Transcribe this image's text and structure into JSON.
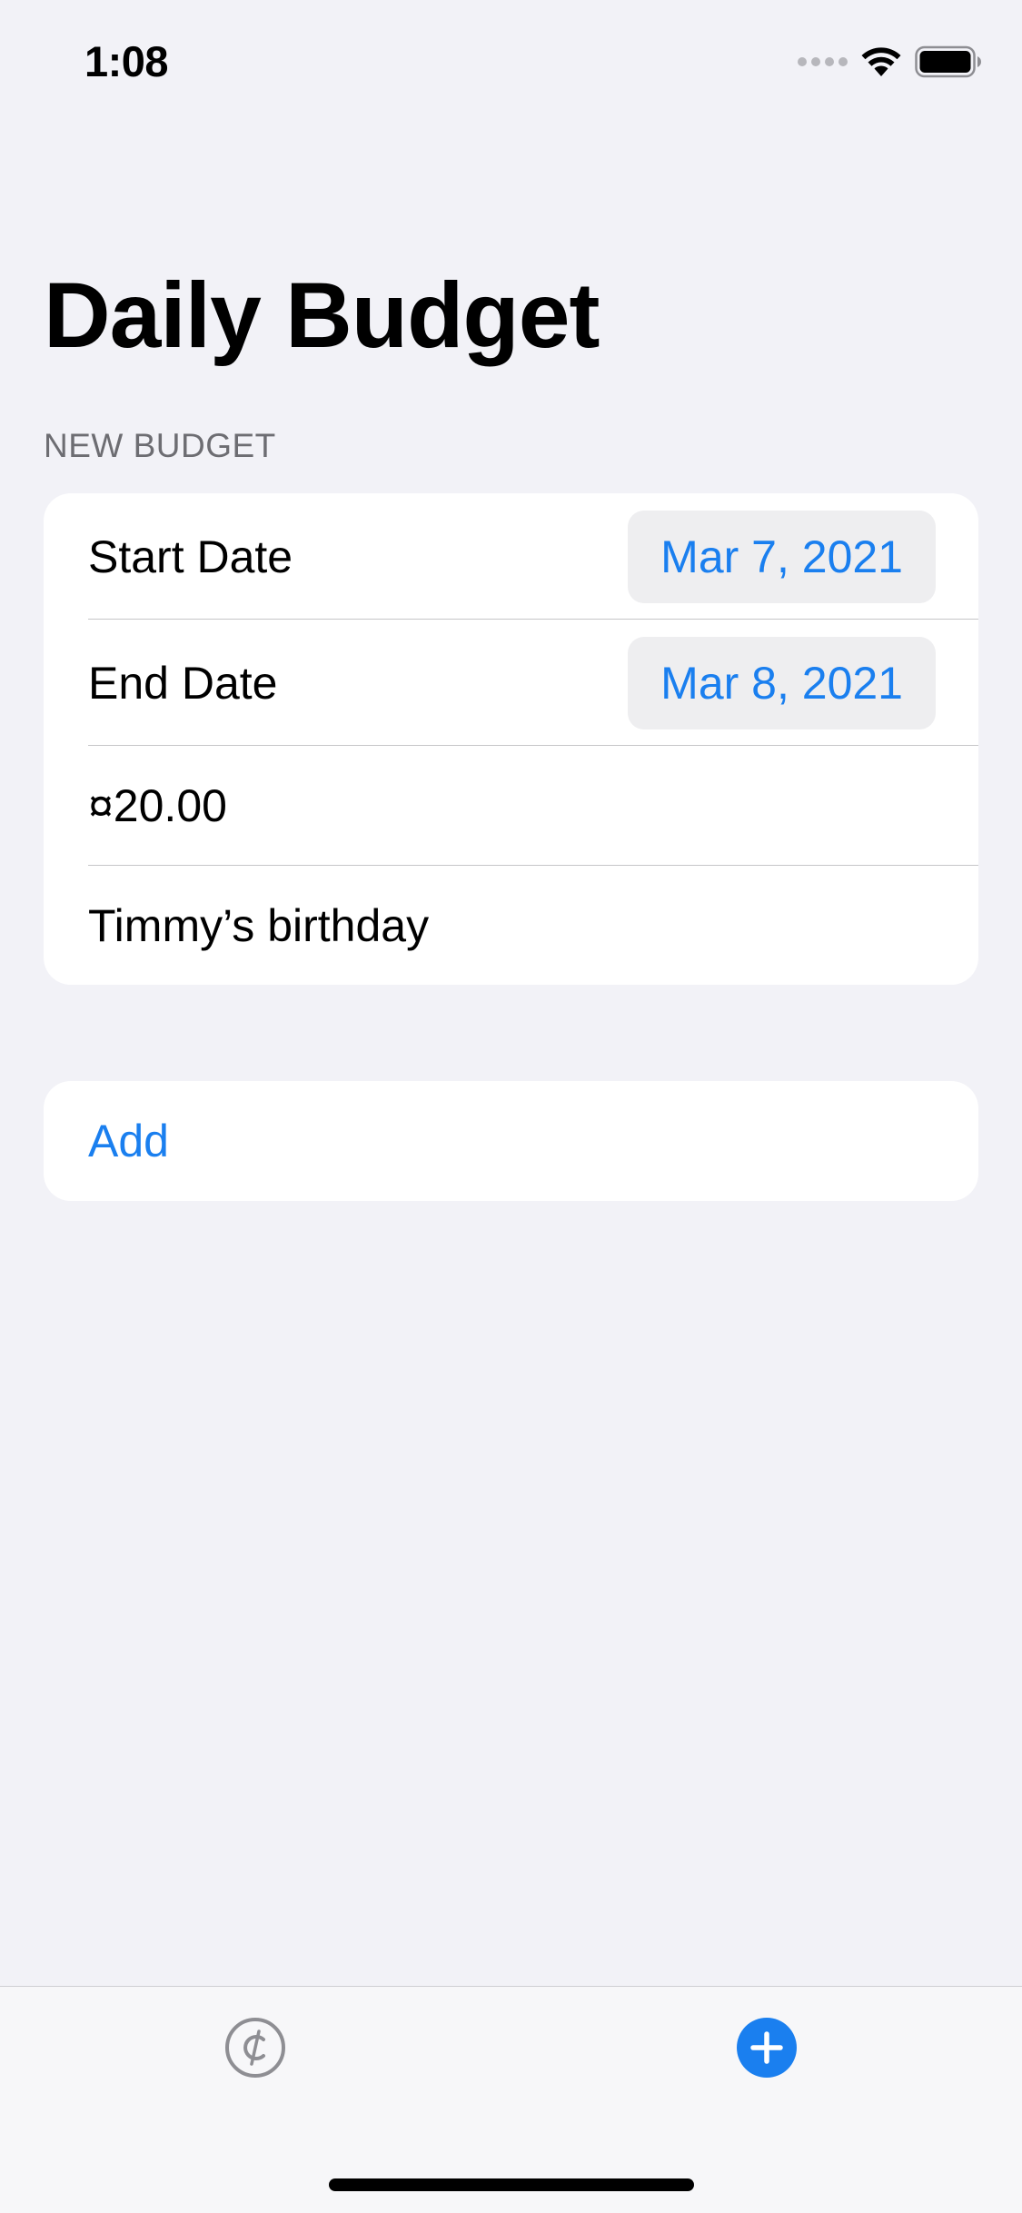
{
  "status_bar": {
    "time": "1:08"
  },
  "header": {
    "title": "Daily Budget"
  },
  "form": {
    "section_header": "NEW BUDGET",
    "start_date": {
      "label": "Start Date",
      "value": "Mar 7, 2021"
    },
    "end_date": {
      "label": "End Date",
      "value": "Mar 8, 2021"
    },
    "amount_value": "¤20.00",
    "note_value": "Timmy’s birthday"
  },
  "actions": {
    "add_label": "Add"
  },
  "tab_bar": {
    "items": [
      {
        "icon": "cent-circle-icon",
        "selected": false
      },
      {
        "icon": "plus-circle-fill-icon",
        "selected": true
      }
    ]
  },
  "colors": {
    "accent": "#1a7fef",
    "background": "#f2f2f7",
    "card": "#ffffff",
    "secondary_text": "#6d6d72",
    "tab_inactive": "#8e8e93"
  }
}
